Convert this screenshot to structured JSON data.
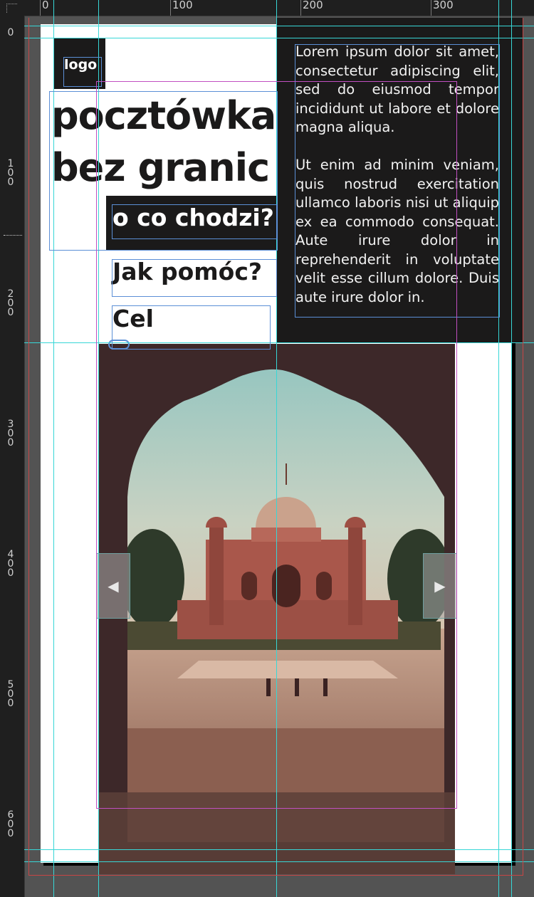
{
  "rulers": {
    "top": [
      "0",
      "100",
      "200",
      "300"
    ],
    "left": [
      "0",
      "100",
      "200",
      "300",
      "400",
      "500",
      "600"
    ]
  },
  "document": {
    "logo": "logo",
    "title_line1": "pocztówka",
    "title_line2": "bez granic",
    "nav": {
      "o_co_chodzi": "o co chodzi?",
      "jak_pomoc": "Jak pomóc?",
      "cel": "Cel"
    },
    "body_paragraph_1": "Lorem ipsum dolor sit amet, consectetur adipiscing elit, sed do eiusmod tempor incididunt ut labore et dolore magna aliqua.",
    "body_paragraph_2": "Ut enim ad minim veniam, quis nostrud exercitation ullamco laboris nisi ut aliquip ex ea commodo consequat. Aute irure dolor in reprehenderit in voluptate velit esse cillum dolore. Duis aute irure dolor in."
  },
  "icons": {
    "link": "link-icon",
    "prev": "chevron-left-icon",
    "next": "chevron-right-icon"
  },
  "colors": {
    "pasteboard": "#535353",
    "page": "#ffffff",
    "dark": "#1b1a1a",
    "guide": "#37d7d7",
    "frame": "#5b8fd6",
    "margin": "#c14fc1"
  }
}
